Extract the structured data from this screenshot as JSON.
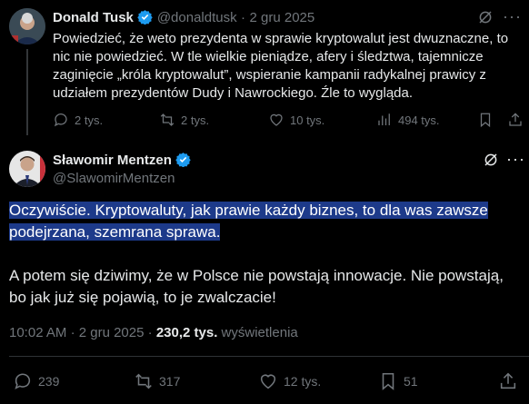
{
  "post1": {
    "author_name": "Donald Tusk",
    "handle": "@donaldtusk",
    "separator": "·",
    "date": "2 gru 2025",
    "text": "Powiedzieć, że weto prezydenta w sprawie kryptowalut jest dwuznaczne, to nic nie powiedzieć. W tle wielkie pieniądze, afery i śledztwa, tajemnicze zaginięcie „króla kryptowalut”, wspieranie kampanii radykalnej prawicy z udziałem prezydentów Dudy i Nawrockiego. Źle to wygląda.",
    "stats": {
      "replies": "2 tys.",
      "reposts": "2 tys.",
      "likes": "10 tys.",
      "views": "494 tys."
    }
  },
  "post2": {
    "author_name": "Sławomir Mentzen",
    "handle": "@SlawomirMentzen",
    "text_highlighted": "Oczywiście. Kryptowaluty, jak prawie każdy biznes, to dla was zawsze podejrzana, szemrana sprawa.",
    "text_rest": "A potem się dziwimy, że w Polsce nie powstają innowacje. Nie powstają, bo jak już się pojawią, to je zwalczacie!",
    "meta": {
      "time": "10:02 AM",
      "separator1": "·",
      "date": "2 gru 2025",
      "separator2": "·",
      "views": "230,2 tys.",
      "views_label": "wyświetlenia"
    },
    "stats": {
      "replies": "239",
      "reposts": "317",
      "likes": "12 tys.",
      "bookmarks": "51"
    }
  },
  "colors": {
    "background": "#000000",
    "text": "#e7e9ea",
    "muted": "#71767b",
    "verified": "#1d9bf0",
    "highlight": "#1d3a8a"
  }
}
